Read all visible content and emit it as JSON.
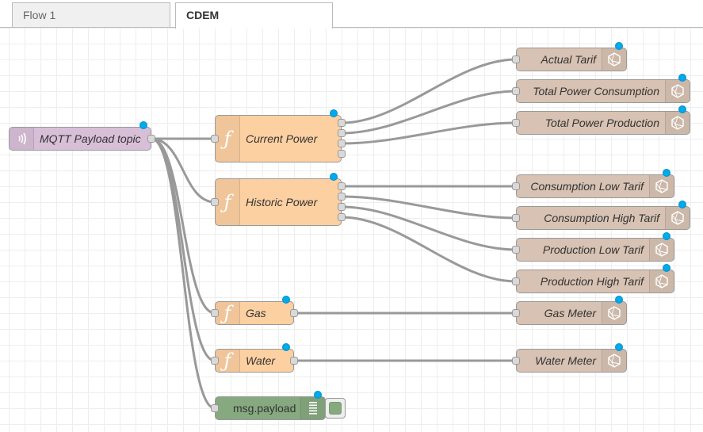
{
  "tabs": [
    {
      "label": "Flow 1",
      "active": false
    },
    {
      "label": "CDEM",
      "active": true
    }
  ],
  "colors": {
    "mqtt_node": "#d8bfd8",
    "function_node": "#fdd0a2",
    "output_node": "#d7c2b3",
    "debug_node": "#87a980",
    "status_dot": "#00a9ec",
    "wire": "#999999"
  },
  "nodes": {
    "mqtt_in": {
      "label": "MQTT Payload topic",
      "icon": "radio-waves-icon",
      "type": "mqtt in"
    },
    "current_power": {
      "label": "Current Power",
      "icon": "function-icon",
      "type": "function",
      "outputs": 4
    },
    "historic_power": {
      "label": "Historic Power",
      "icon": "function-icon",
      "type": "function",
      "outputs": 4
    },
    "gas": {
      "label": "Gas",
      "icon": "function-icon",
      "type": "function",
      "outputs": 1
    },
    "water": {
      "label": "Water",
      "icon": "function-icon",
      "type": "function",
      "outputs": 1
    },
    "debug": {
      "label": "msg.payload",
      "icon": "list-icon",
      "type": "debug"
    },
    "actual_tarif": {
      "label": "Actual Tarif",
      "icon": "polyhedron-icon",
      "type": "output"
    },
    "total_power_consumption": {
      "label": "Total Power Consumption",
      "icon": "polyhedron-icon",
      "type": "output"
    },
    "total_power_production": {
      "label": "Total Power Production",
      "icon": "polyhedron-icon",
      "type": "output"
    },
    "consumption_low_tarif": {
      "label": "Consumption Low Tarif",
      "icon": "polyhedron-icon",
      "type": "output"
    },
    "consumption_high_tarif": {
      "label": "Consumption High Tarif",
      "icon": "polyhedron-icon",
      "type": "output"
    },
    "production_low_tarif": {
      "label": "Production Low Tarif",
      "icon": "polyhedron-icon",
      "type": "output"
    },
    "production_high_tarif": {
      "label": "Production High Tarif",
      "icon": "polyhedron-icon",
      "type": "output"
    },
    "gas_meter": {
      "label": "Gas Meter",
      "icon": "polyhedron-icon",
      "type": "output"
    },
    "water_meter": {
      "label": "Water Meter",
      "icon": "polyhedron-icon",
      "type": "output"
    }
  },
  "wires": [
    {
      "from": "mqtt_in",
      "port": 0,
      "to": "current_power"
    },
    {
      "from": "mqtt_in",
      "port": 0,
      "to": "historic_power"
    },
    {
      "from": "mqtt_in",
      "port": 0,
      "to": "gas"
    },
    {
      "from": "mqtt_in",
      "port": 0,
      "to": "water"
    },
    {
      "from": "mqtt_in",
      "port": 0,
      "to": "debug"
    },
    {
      "from": "current_power",
      "port": 0,
      "to": "actual_tarif"
    },
    {
      "from": "current_power",
      "port": 1,
      "to": "total_power_consumption"
    },
    {
      "from": "current_power",
      "port": 2,
      "to": "total_power_production"
    },
    {
      "from": "historic_power",
      "port": 0,
      "to": "consumption_low_tarif"
    },
    {
      "from": "historic_power",
      "port": 1,
      "to": "consumption_high_tarif"
    },
    {
      "from": "historic_power",
      "port": 2,
      "to": "production_low_tarif"
    },
    {
      "from": "historic_power",
      "port": 3,
      "to": "production_high_tarif"
    },
    {
      "from": "gas",
      "port": 0,
      "to": "gas_meter"
    },
    {
      "from": "water",
      "port": 0,
      "to": "water_meter"
    }
  ]
}
